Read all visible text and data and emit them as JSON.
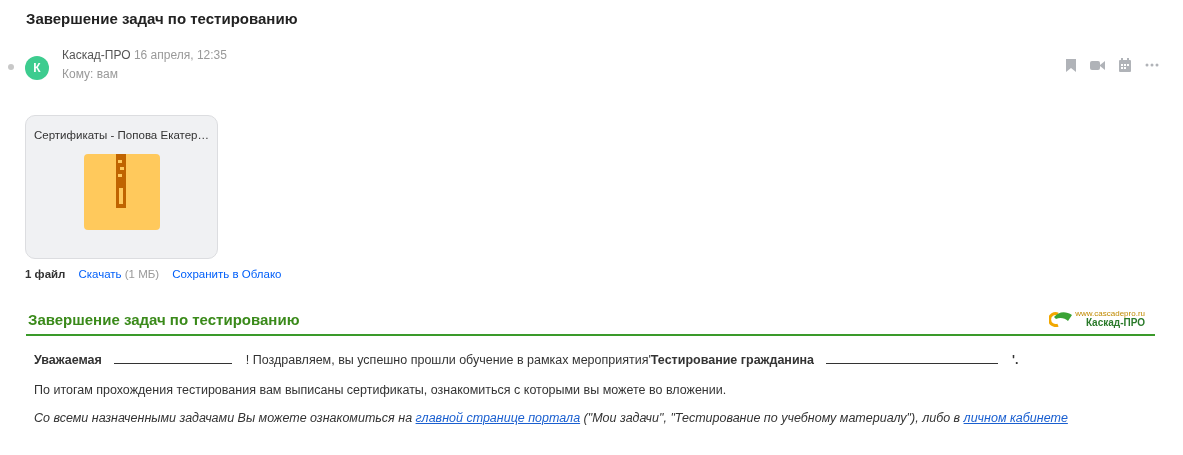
{
  "subject": "Завершение задач по тестированию",
  "message": {
    "avatar": "К",
    "sender": "Каскад-ПРО",
    "date": "16 апреля, 12:35",
    "recipient": "Кому: вам",
    "unread": false
  },
  "attachment": {
    "name": "Сертификаты - Попова Екатер…",
    "count": "1 файл",
    "download": "Скачать",
    "size": "(1 МБ)",
    "save": "Сохранить в Облако"
  },
  "body": {
    "title": "Завершение задач по тестированию",
    "logo_url": "www.cascadepro.ru",
    "logo_name": "Каскад-ПРО",
    "greeting": {
      "salutation": "Уважаемая",
      "text": "! Поздравляем, вы успешно прошли обучение в рамках мероприятия'**Тестирование гражданина**",
      "end": "'."
    },
    "info": "По итогам прохождения тестирования вам выписаны сертификаты, ознакомиться с которыми вы можете во вложении.",
    "note": [
      {
        "kind": "text",
        "text": "Со всеми назначенными задачами Вы можете ознакомиться на "
      },
      {
        "kind": "link",
        "text": "главной странице портала"
      },
      {
        "kind": "text",
        "text": " (\"Мои задачи\", \"Тестирование по учебному материалу\"), либо в "
      },
      {
        "kind": "link",
        "text": "личном кабинете"
      }
    ]
  }
}
